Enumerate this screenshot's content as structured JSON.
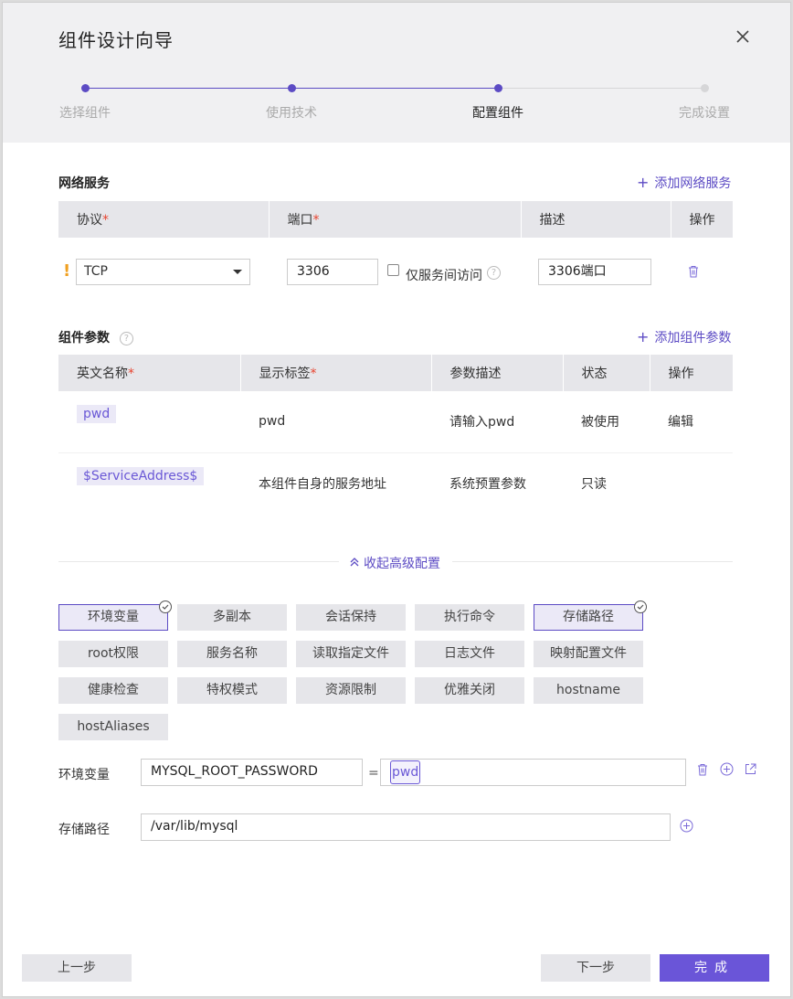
{
  "dialog": {
    "title": "组件设计向导"
  },
  "steps": [
    {
      "label": "选择组件",
      "state": "done"
    },
    {
      "label": "使用技术",
      "state": "done"
    },
    {
      "label": "配置组件",
      "state": "active"
    },
    {
      "label": "完成设置",
      "state": "todo"
    }
  ],
  "network": {
    "title": "网络服务",
    "add_label": "添加网络服务",
    "columns": [
      "协议",
      "端口",
      "描述",
      "操作"
    ],
    "row": {
      "warning": "!",
      "protocol": "TCP",
      "port": "3306",
      "internal_only_label": "仅服务间访问",
      "internal_only_checked": false,
      "description": "3306端口"
    }
  },
  "params": {
    "title": "组件参数",
    "add_label": "添加组件参数",
    "columns": [
      "英文名称",
      "显示标签",
      "参数描述",
      "状态",
      "操作"
    ],
    "rows": [
      {
        "name": "pwd",
        "label": "pwd",
        "desc": "请输入pwd",
        "status": "被使用",
        "action": "编辑"
      },
      {
        "name": "$ServiceAddress$",
        "label": "本组件自身的服务地址",
        "desc": "系统预置参数",
        "status": "只读",
        "action": ""
      }
    ]
  },
  "advanced": {
    "toggle_label": "收起高级配置",
    "options": [
      {
        "label": "环境变量",
        "active": true
      },
      {
        "label": "多副本",
        "active": false
      },
      {
        "label": "会话保持",
        "active": false
      },
      {
        "label": "执行命令",
        "active": false
      },
      {
        "label": "存储路径",
        "active": true
      },
      {
        "label": "root权限",
        "active": false
      },
      {
        "label": "服务名称",
        "active": false
      },
      {
        "label": "读取指定文件",
        "active": false
      },
      {
        "label": "日志文件",
        "active": false
      },
      {
        "label": "映射配置文件",
        "active": false
      },
      {
        "label": "健康检查",
        "active": false
      },
      {
        "label": "特权模式",
        "active": false
      },
      {
        "label": "资源限制",
        "active": false
      },
      {
        "label": "优雅关闭",
        "active": false
      },
      {
        "label": "hostname",
        "active": false
      },
      {
        "label": "hostAliases",
        "active": false
      }
    ]
  },
  "env": {
    "label": "环境变量",
    "key": "MYSQL_ROOT_PASSWORD",
    "equals": "=",
    "value": "pwd"
  },
  "storage": {
    "label": "存储路径",
    "path": "/var/lib/mysql"
  },
  "footer": {
    "prev_label": "上一步",
    "next_label": "下一步",
    "finish_label": "完成"
  },
  "colors": {
    "accent": "#5c4bc4",
    "primary_button": "#6a55d8",
    "required": "#e8442f",
    "warning": "#f0a020"
  }
}
